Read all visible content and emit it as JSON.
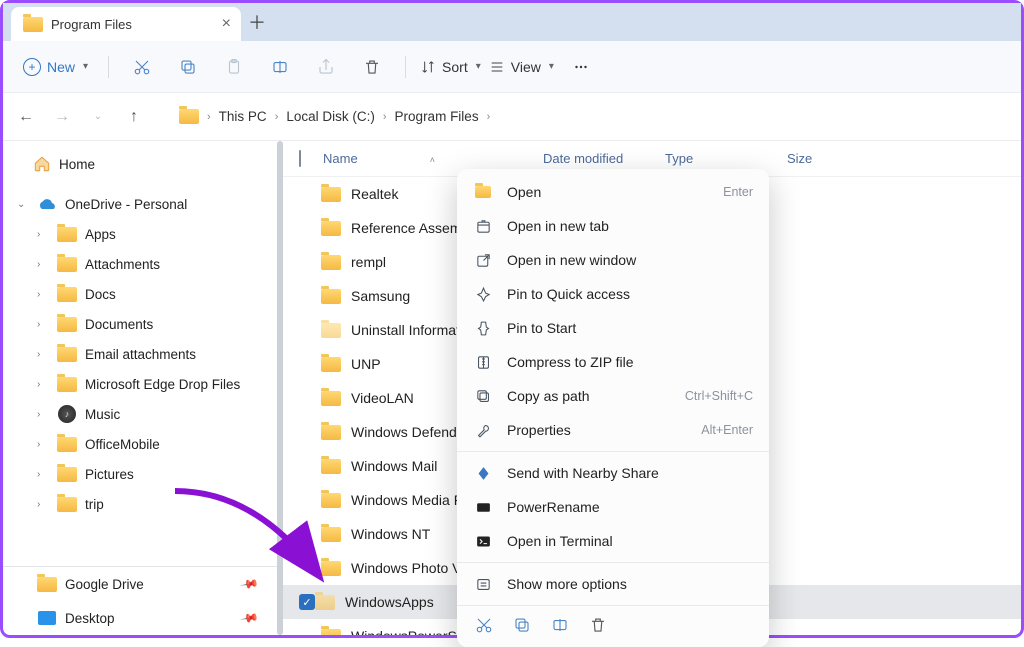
{
  "tab": {
    "title": "Program Files"
  },
  "toolbar": {
    "new_label": "New",
    "sort_label": "Sort",
    "view_label": "View"
  },
  "breadcrumbs": [
    "This PC",
    "Local Disk (C:)",
    "Program Files"
  ],
  "sidebar": {
    "home": "Home",
    "onedrive": "OneDrive - Personal",
    "items": [
      "Apps",
      "Attachments",
      "Docs",
      "Documents",
      "Email attachments",
      "Microsoft Edge Drop Files",
      "Music",
      "OfficeMobile",
      "Pictures",
      "trip"
    ],
    "bottom": [
      "Google Drive",
      "Desktop"
    ]
  },
  "columns": {
    "name": "Name",
    "date": "Date modified",
    "type": "Type",
    "size": "Size"
  },
  "files": [
    {
      "name": "Realtek",
      "faint": false
    },
    {
      "name": "Reference Assemb",
      "faint": false
    },
    {
      "name": "rempl",
      "faint": false
    },
    {
      "name": "Samsung",
      "faint": false
    },
    {
      "name": "Uninstall Informati",
      "faint": true
    },
    {
      "name": "UNP",
      "faint": false
    },
    {
      "name": "VideoLAN",
      "faint": false
    },
    {
      "name": "Windows Defende",
      "faint": false
    },
    {
      "name": "Windows Mail",
      "faint": false
    },
    {
      "name": "Windows Media Pl",
      "faint": false
    },
    {
      "name": "Windows NT",
      "faint": false
    },
    {
      "name": "Windows Photo Vi",
      "faint": false
    },
    {
      "name": "WindowsApps",
      "faint": true,
      "selected": true
    },
    {
      "name": "WindowsPowerShe",
      "faint": false
    }
  ],
  "context_menu": {
    "open": "Open",
    "open_short": "Enter",
    "open_tab": "Open in new tab",
    "open_win": "Open in new window",
    "pin_quick": "Pin to Quick access",
    "pin_start": "Pin to Start",
    "compress": "Compress to ZIP file",
    "copy_path": "Copy as path",
    "copy_path_short": "Ctrl+Shift+C",
    "properties": "Properties",
    "properties_short": "Alt+Enter",
    "nearby": "Send with Nearby Share",
    "powerrename": "PowerRename",
    "terminal": "Open in Terminal",
    "more": "Show more options"
  }
}
